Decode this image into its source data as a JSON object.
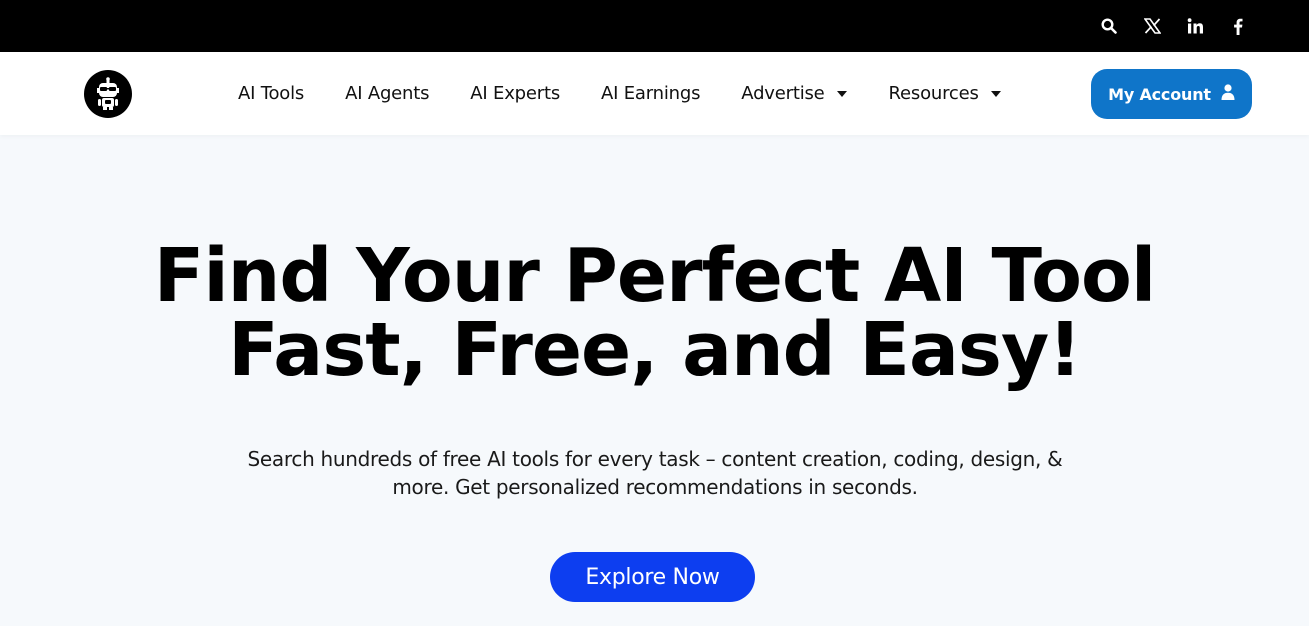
{
  "topbar": {
    "icons": [
      "search-icon",
      "x-twitter-icon",
      "linkedin-icon",
      "facebook-icon"
    ]
  },
  "nav": {
    "logo_icon": "robot-sunglasses-logo",
    "items": [
      {
        "label": "AI Tools",
        "dropdown": false
      },
      {
        "label": "AI Agents",
        "dropdown": false
      },
      {
        "label": "AI Experts",
        "dropdown": false
      },
      {
        "label": "AI Earnings",
        "dropdown": false
      },
      {
        "label": "Advertise",
        "dropdown": true
      },
      {
        "label": "Resources",
        "dropdown": true
      }
    ],
    "account_label": "My Account",
    "account_icon": "user-icon"
  },
  "hero": {
    "headline_line1": "Find Your Perfect AI Tool",
    "headline_line2": "Fast, Free, and Easy!",
    "subtitle": "Search hundreds of free AI tools for every task – content creation, coding, design, & more. Get personalized recommendations in seconds.",
    "cta_label": "Explore Now"
  },
  "colors": {
    "topbar_bg": "#000000",
    "account_button": "#0f75c9",
    "cta_button": "#0d3ef0",
    "hero_bg": "#f6f9fc"
  }
}
